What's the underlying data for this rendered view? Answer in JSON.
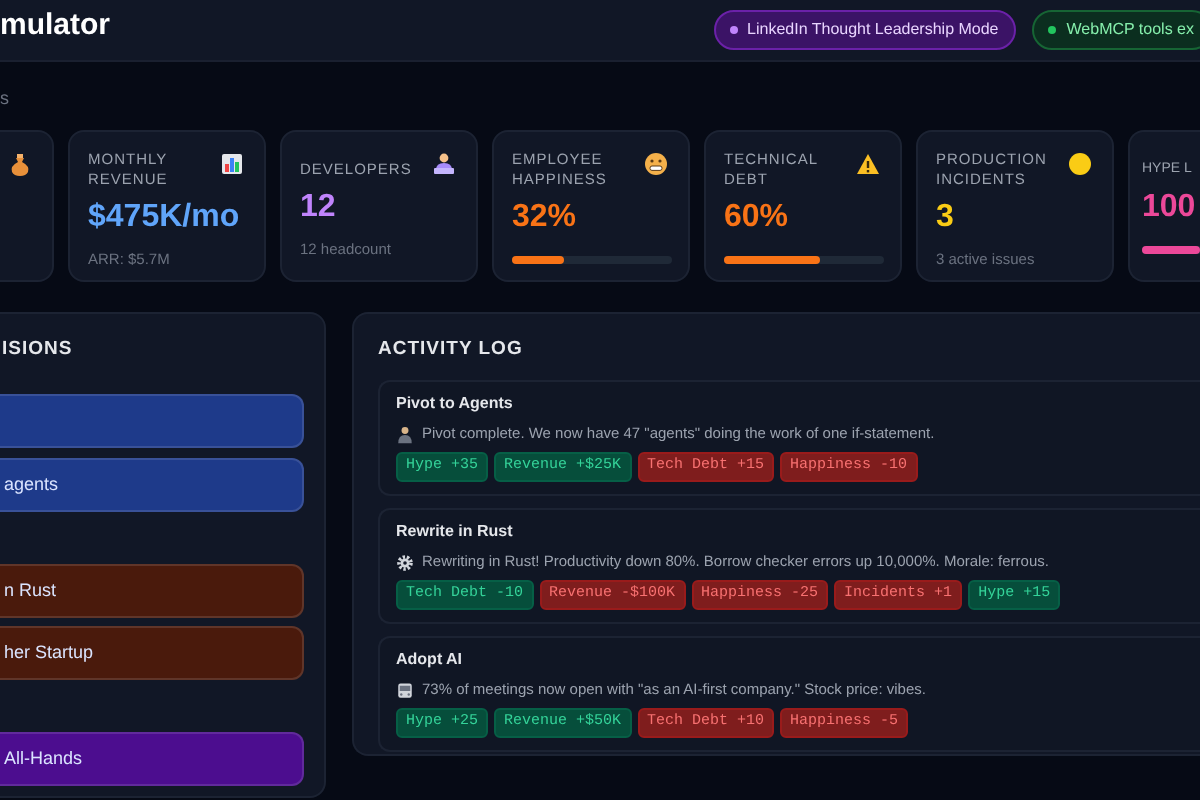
{
  "header": {
    "title": "mulator",
    "badges": [
      {
        "label": "LinkedIn Thought Leadership Mode",
        "color": "#c084fc"
      },
      {
        "label": "WebMCP tools ex",
        "color": "#22c55e"
      }
    ]
  },
  "section_label": "s",
  "stats": [
    {
      "kind": "cut"
    },
    {
      "kind": "text",
      "label": "MONTHLY REVENUE",
      "value": "$475K/mo",
      "sub": "ARR: $5.7M",
      "color": "#60a5fa"
    },
    {
      "kind": "text",
      "label": "DEVELOPERS",
      "value": "12",
      "sub": "12 headcount",
      "color": "#c084fc"
    },
    {
      "kind": "bar",
      "label": "EMPLOYEE HAPPINESS",
      "value": "32%",
      "level": 0.32,
      "color": "#f97316"
    },
    {
      "kind": "bar",
      "label": "TECHNICAL DEBT",
      "value": "60%",
      "level": 0.6,
      "color": "#f97316"
    },
    {
      "kind": "text",
      "label": "PRODUCTION INCIDENTS",
      "value": "3",
      "sub": "3 active issues",
      "color": "#facc15"
    },
    {
      "kind": "bar",
      "label": "HYPE L",
      "value": "100",
      "level": 1,
      "color": "#ec4899"
    }
  ],
  "decisions": {
    "title": "ISIONS",
    "buttons": [
      {
        "color": "#1e3a8a"
      },
      {
        "label": "agents",
        "color": "#1e3a8a"
      },
      {
        "label": "n Rust",
        "color": "#4a1a0c"
      },
      {
        "label": "her Startup",
        "color": "#4a1a0c"
      },
      {
        "label": "All-Hands",
        "color": "#4c0d8f"
      }
    ]
  },
  "activity_log": {
    "title": "ACTIVITY LOG",
    "entries": [
      {
        "title": "Pivot to Agents",
        "text": "Pivot complete. We now have 47 \"agents\" doing the work of one if-statement.",
        "effects": [
          {
            "label": "Hype +35",
            "kind": "positive"
          },
          {
            "label": "Revenue +$25K",
            "kind": "positive"
          },
          {
            "label": "Tech Debt +15",
            "kind": "negative"
          },
          {
            "label": "Happiness -10",
            "kind": "negative"
          }
        ]
      },
      {
        "title": "Rewrite in Rust",
        "text": "Rewriting in Rust! Productivity down 80%. Borrow checker errors up 10,000%. Morale: ferrous.",
        "effects": [
          {
            "label": "Tech Debt -10",
            "kind": "positive"
          },
          {
            "label": "Revenue -$100K",
            "kind": "negative"
          },
          {
            "label": "Happiness -25",
            "kind": "negative"
          },
          {
            "label": "Incidents +1",
            "kind": "negative"
          },
          {
            "label": "Hype +15",
            "kind": "positive"
          }
        ]
      },
      {
        "title": "Adopt AI",
        "text": "73% of meetings now open with \"as an AI-first company.\" Stock price: vibes.",
        "effects": [
          {
            "label": "Hype +25",
            "kind": "positive"
          },
          {
            "label": "Revenue +$50K",
            "kind": "positive"
          },
          {
            "label": "Tech Debt +10",
            "kind": "negative"
          },
          {
            "label": "Happiness -5",
            "kind": "negative"
          }
        ]
      }
    ]
  }
}
